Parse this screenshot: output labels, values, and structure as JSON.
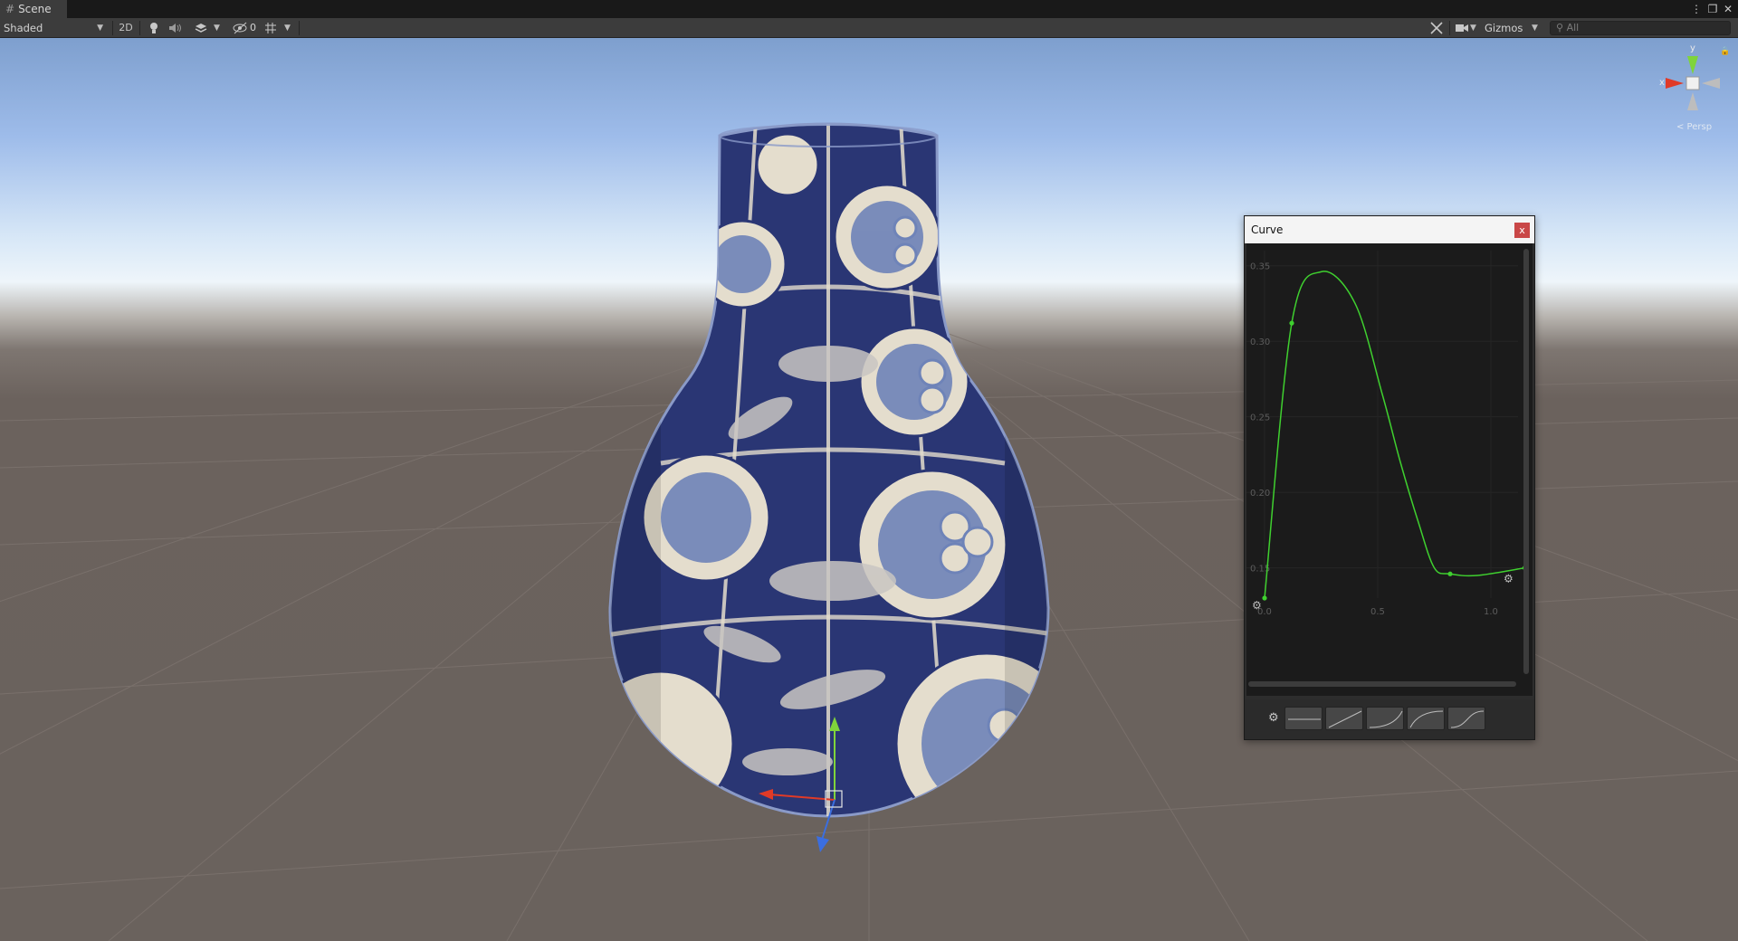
{
  "tab": {
    "label": "Scene",
    "hash_icon": "#"
  },
  "window_controls": {
    "menu": "⋮",
    "maximize": "❐",
    "close": "✕"
  },
  "toolbar": {
    "shading_mode": "Shaded",
    "btn_2d": "2D",
    "hidden_count": "0",
    "gizmos_label": "Gizmos",
    "search_placeholder": "All",
    "icons": [
      "lighting-icon",
      "audio-icon",
      "effects-icon",
      "scene-visibility-icon",
      "grid-icon",
      "tools-icon",
      "camera-icon"
    ]
  },
  "scene": {
    "orientation_gizmo": {
      "y_label": "y",
      "x_label": "x",
      "projection_label": "< Persp"
    }
  },
  "curve_window": {
    "title": "Curve",
    "close_label": "x",
    "y_ticks": [
      "0.35",
      "0.30",
      "0.25",
      "0.20",
      "0.15"
    ],
    "x_ticks": [
      "0.0",
      "0.5",
      "1.0"
    ],
    "presets": [
      "constant",
      "linear",
      "ease-in",
      "ease-out",
      "ease-in-out"
    ]
  },
  "chart_data": {
    "type": "line",
    "title": "",
    "xlabel": "",
    "ylabel": "",
    "xlim": [
      -0.08,
      1.12
    ],
    "ylim": [
      0.13,
      0.36
    ],
    "series": [
      {
        "x": [
          0.0,
          0.12,
          0.25,
          0.4,
          0.52,
          0.6,
          0.68,
          0.75,
          0.82,
          0.94,
          1.15
        ],
        "y": [
          0.13,
          0.312,
          0.346,
          0.325,
          0.265,
          0.22,
          0.18,
          0.15,
          0.146,
          0.145,
          0.15
        ]
      }
    ],
    "keyframes": [
      {
        "x": 0.0,
        "y": 0.13
      },
      {
        "x": 0.12,
        "y": 0.312
      },
      {
        "x": 0.82,
        "y": 0.146
      },
      {
        "x": 1.15,
        "y": 0.15
      }
    ],
    "line_color": "#3fd02f",
    "grid": true
  },
  "colors": {
    "toolbar_bg": "#3c3c3c",
    "curve_bg": "#1b1b1b",
    "vase_blue": "#2a3674",
    "vase_cream": "#e4ddcd",
    "handle_x": "#e03a27",
    "handle_y": "#7fd43b",
    "handle_z": "#3b6ee0"
  }
}
